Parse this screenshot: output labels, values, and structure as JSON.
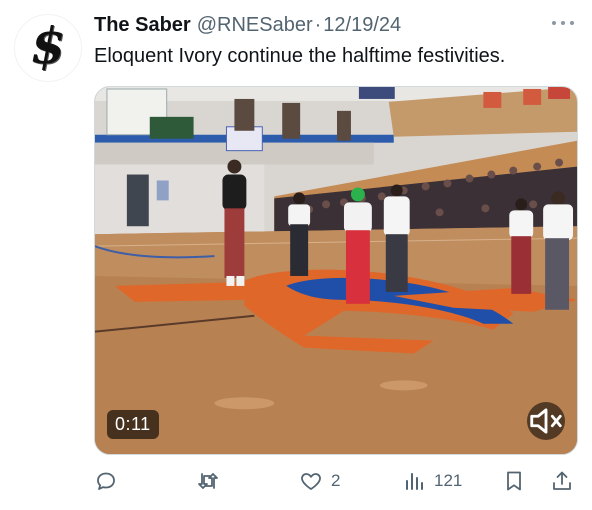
{
  "tweet": {
    "author_name": "The Saber",
    "handle": "@RNESaber",
    "separator": "·",
    "date": "12/19/24",
    "text": "Eloquent Ivory continue the halftime festivities."
  },
  "media": {
    "type": "video",
    "duration": "0:11",
    "mute_icon": "speaker-muted-icon",
    "banners": [
      "",
      "",
      "",
      ""
    ]
  },
  "actions": {
    "reply_count": "",
    "retweet_count": "",
    "like_count": "2",
    "views_count": "121",
    "bookmark_count": "",
    "share_count": ""
  },
  "icons": {
    "more": "more-horizontal-icon",
    "reply": "reply-icon",
    "retweet": "retweet-icon",
    "like": "heart-icon",
    "views": "views-chart-icon",
    "bookmark": "bookmark-icon",
    "share": "share-icon"
  },
  "colors": {
    "text": "#0f1419",
    "muted": "#536471",
    "court": "#b07a48",
    "logo_orange": "#e0672a",
    "logo_blue": "#1f4fa8"
  }
}
